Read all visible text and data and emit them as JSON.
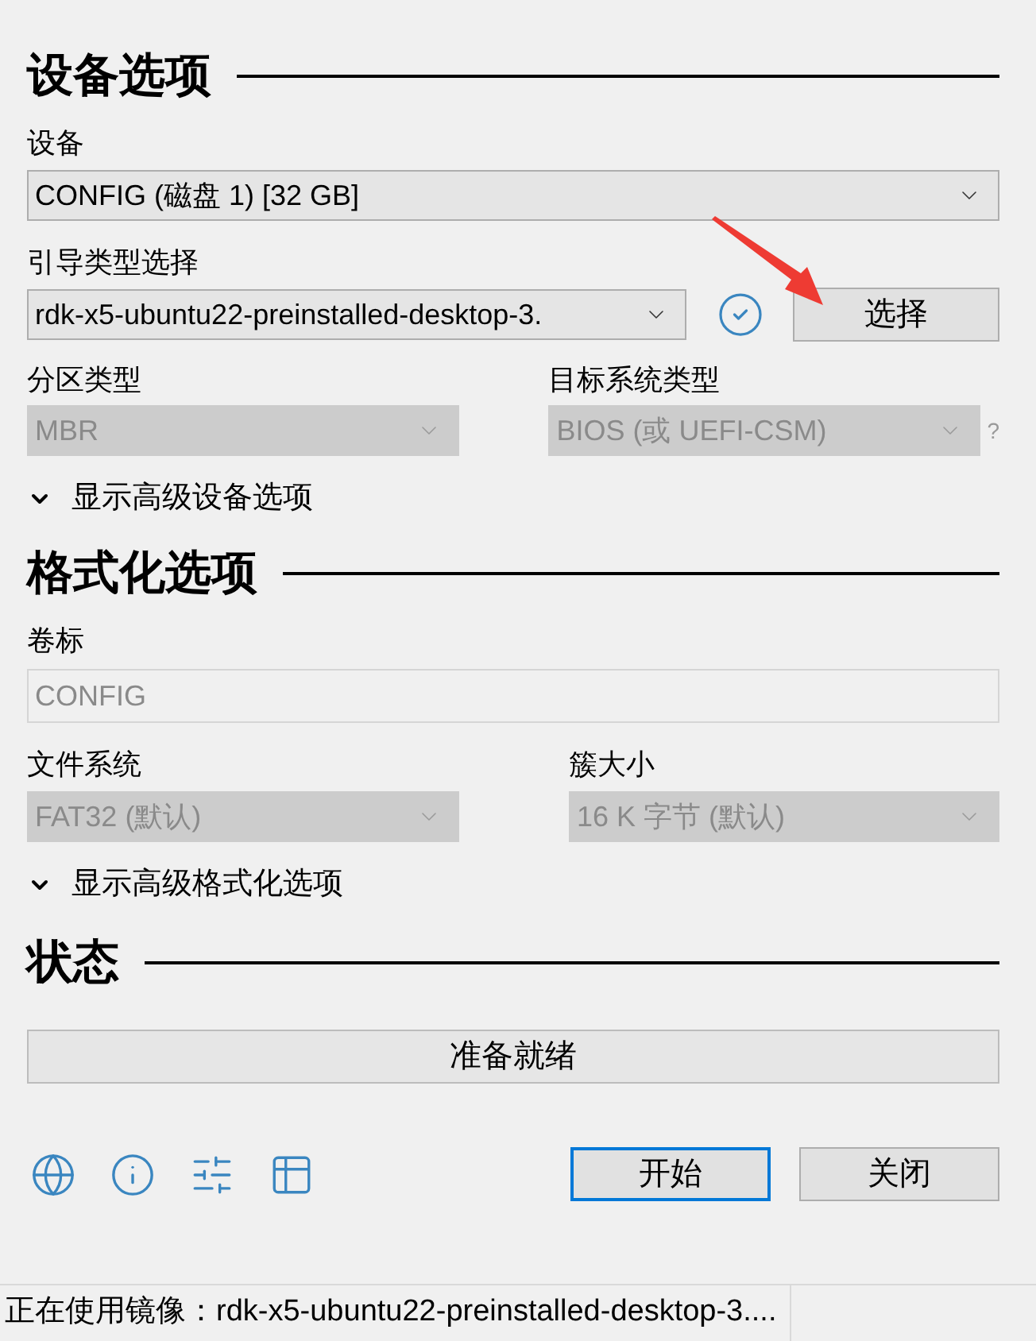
{
  "device_options": {
    "heading": "设备选项",
    "device": {
      "label": "设备",
      "value": "CONFIG (磁盘 1) [32 GB]",
      "disabled": false
    },
    "boot": {
      "label": "引导类型选择",
      "value": "rdk-x5-ubuntu22-preinstalled-desktop-3.",
      "disabled": false
    },
    "select_button": "选择",
    "partition": {
      "label": "分区类型",
      "value": "MBR",
      "disabled": true
    },
    "target": {
      "label": "目标系统类型",
      "value": "BIOS (或 UEFI-CSM)",
      "disabled": true
    },
    "help": "?",
    "advanced": {
      "label": "显示高级设备选项",
      "expanded": false
    }
  },
  "format_options": {
    "heading": "格式化选项",
    "volume": {
      "label": "卷标",
      "value": "CONFIG",
      "disabled": true
    },
    "filesystem": {
      "label": "文件系统",
      "value": "FAT32 (默认)",
      "disabled": true
    },
    "cluster": {
      "label": "簇大小",
      "value": "16 K 字节 (默认)",
      "disabled": true
    },
    "advanced": {
      "label": "显示高级格式化选项",
      "expanded": false
    }
  },
  "status": {
    "heading": "状态",
    "progress_text": "准备就绪"
  },
  "buttons": [
    {
      "label": "开始",
      "focused": true
    },
    {
      "label": "关闭",
      "focused": false
    }
  ],
  "status_bar": "正在使用镜像：rdk-x5-ubuntu22-preinstalled-desktop-3...."
}
